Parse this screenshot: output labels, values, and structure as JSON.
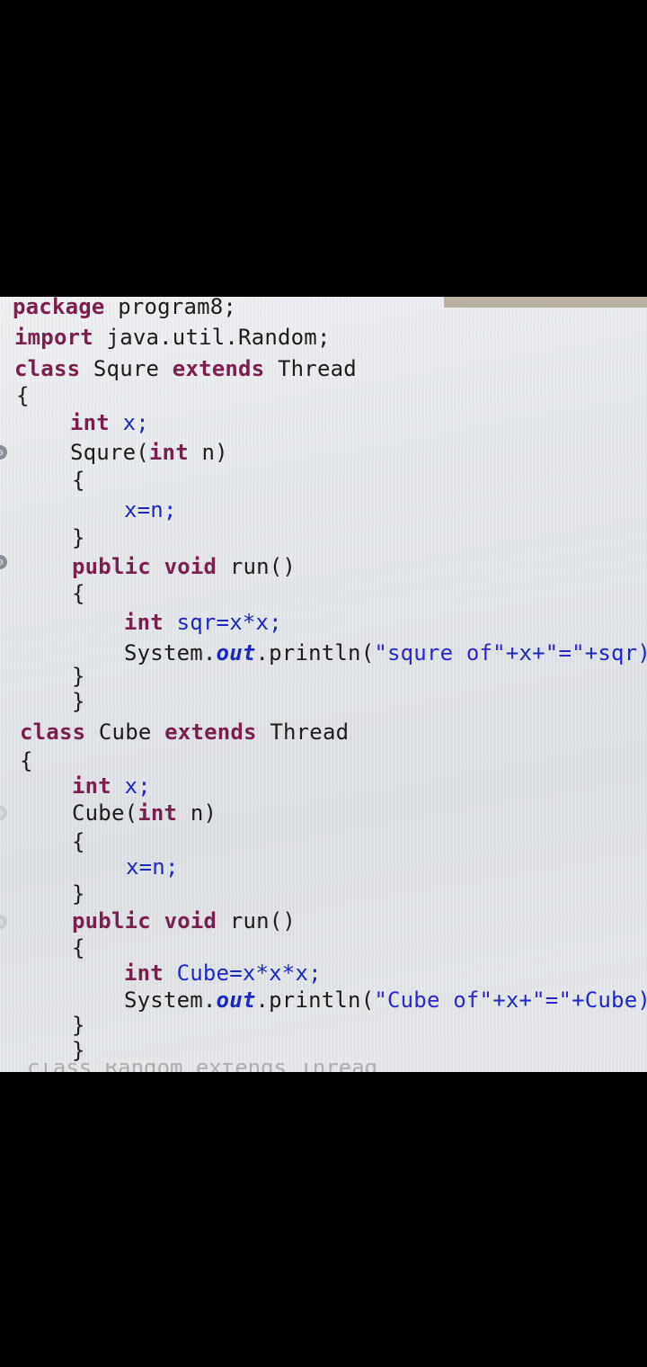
{
  "editor": {
    "lines": [
      [
        "package",
        " program8;"
      ],
      [
        "import",
        " java.util.Random;"
      ],
      [
        "class",
        " Squre ",
        "extends",
        " Thread"
      ],
      [
        "{"
      ],
      [
        "int",
        " x;"
      ],
      [
        "Squre(",
        "int",
        " n)"
      ],
      [
        "{"
      ],
      [
        "x=n;"
      ],
      [
        "}"
      ],
      [
        "public",
        " ",
        "void",
        " run()"
      ],
      [
        "{"
      ],
      [
        "int",
        " sqr=x*x;"
      ],
      [
        "System.",
        "out",
        ".println(",
        "\"squre of\"",
        "+x+",
        "\"=\"",
        "+sqr);"
      ],
      [
        "}"
      ],
      [
        "}"
      ],
      [
        "class",
        " Cube ",
        "extends",
        " Thread"
      ],
      [
        "{"
      ],
      [
        "int",
        " x;"
      ],
      [
        "Cube(",
        "int",
        " n)"
      ],
      [
        "{"
      ],
      [
        "x=n;"
      ],
      [
        "}"
      ],
      [
        "public",
        " ",
        "void",
        " run()"
      ],
      [
        "{"
      ],
      [
        "int",
        " Cube=x*x*x;"
      ],
      [
        "System.",
        "out",
        ".println(",
        "\"Cube of\"",
        "+x+",
        "\"=\"",
        "+Cube);"
      ],
      [
        "}"
      ],
      [
        "}"
      ]
    ],
    "partial_line": "class Random extends Thread",
    "gutter_marker": "⊖"
  }
}
